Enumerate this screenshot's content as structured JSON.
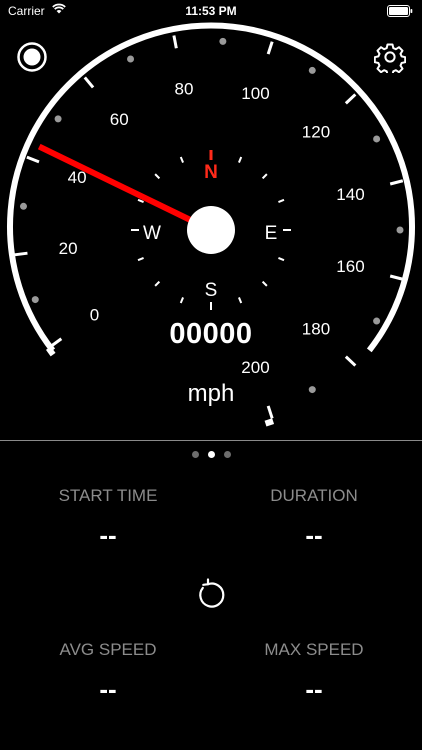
{
  "status_bar": {
    "carrier": "Carrier",
    "time": "11:53 PM"
  },
  "gauge": {
    "speed_labels": [
      "0",
      "20",
      "40",
      "60",
      "80",
      "100",
      "120",
      "140",
      "160",
      "180",
      "200"
    ],
    "compass": {
      "north": "N",
      "south": "S",
      "east": "E",
      "west": "W"
    },
    "odometer": "00000",
    "unit": "mph",
    "needle_value": 43,
    "max_value": 200,
    "needle_color": "#ff0000",
    "north_color": "#ff2a1a"
  },
  "pager": {
    "count": 3,
    "active_index": 1
  },
  "stats": {
    "start_time": {
      "label": "START TIME",
      "value": "--"
    },
    "duration": {
      "label": "DURATION",
      "value": "--"
    },
    "avg_speed": {
      "label": "AVG SPEED",
      "value": "--"
    },
    "max_speed": {
      "label": "MAX SPEED",
      "value": "--"
    }
  },
  "icons": {
    "record": "record-icon",
    "settings": "gear-icon",
    "reset": "reset-icon"
  }
}
